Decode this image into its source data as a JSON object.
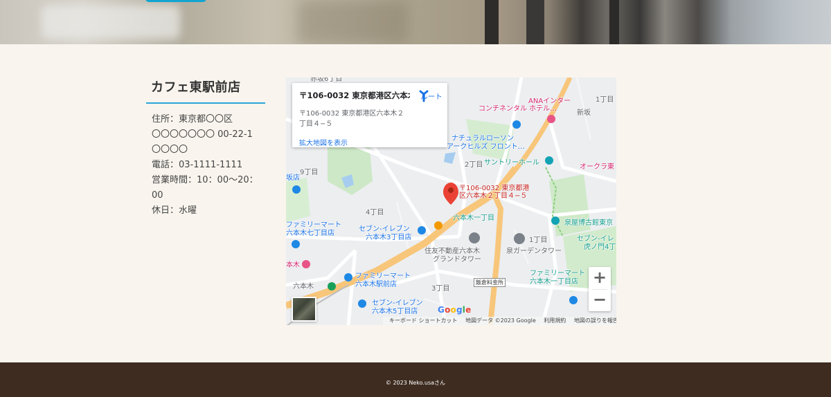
{
  "shop": {
    "name": "カフェ東駅前店",
    "address_line1": "住所：東京都〇〇区",
    "address_line2": "〇〇〇〇〇〇〇 00-22-1",
    "address_line3": "〇〇〇〇",
    "phone": "電話：03-1111-1111",
    "hours_line1": "営業時間：10：00〜20：",
    "hours_line2": "00",
    "holiday": "休日：水曜"
  },
  "map": {
    "card_title": "〒106-0032 東京都港区六本木...",
    "card_address": "〒106-0032 東京都港区六本木２丁目４−５",
    "bigger_map": "拡大地図を表示",
    "route": "ルート",
    "pin_label_1": "〒106-0032 東京都港",
    "pin_label_2": "区六本木２丁目４−５",
    "zoom_in": "+",
    "zoom_out": "−",
    "google": "Google",
    "attribution": {
      "shortcuts": "キーボード ショートカット",
      "map_data": "地図データ ©2023 Google",
      "terms": "利用規約",
      "report": "地図の誤りを報告する"
    },
    "labels": {
      "akasaka": "赤坂6丁目",
      "ana1": "ANAインター",
      "ana2": "コンチネンタル ホテル…",
      "chome1_top": "1丁目",
      "shinkaizaka": "新坂",
      "natural1": "ナチュラルローソン",
      "natural2": "アークヒルズ フロント…",
      "chome2": "2丁目",
      "suntory": "サントリーホール",
      "okura": "オークラ東",
      "chome9": "9丁目",
      "hanten": "坂店",
      "ichome4": "4丁目",
      "roppongi1": "六本木一丁目",
      "izumiya": "泉屋博古館東京",
      "fm7_1": "ファミリーマート",
      "fm7_2": "六本木七丁目店",
      "seven3_1": "セブン-イレブン",
      "seven3_2": "六本木3丁目店",
      "sumitomo1": "住友不動産六本木",
      "sumitomo2": "グランドタワー",
      "chome1b": "1丁目",
      "izumi_garden": "泉ガーデンタワー",
      "seven_t1": "セブン-イレ",
      "seven_t2": "虎ノ門4丁",
      "roppongi_hill": "本木",
      "roppongi_st": "六本木",
      "fm_eki1": "ファミリーマート",
      "fm_eki2": "六本木駅前店",
      "chome3": "3丁目",
      "seven5_1": "セブン-イレブン",
      "seven5_2": "六本木5丁目店",
      "fm1_1": "ファミリーマート",
      "fm1_2": "六本木一丁目店",
      "iikura": "飯倉料金所"
    }
  },
  "footer": {
    "copyright": "© 2023 Neko.usaさん"
  },
  "colors": {
    "accent_line": "#2aa5d8",
    "footer_bg": "#3e2c20",
    "page_bg": "#f9f5ee",
    "map_link": "#1a73e8",
    "pin": "#ea4335"
  }
}
